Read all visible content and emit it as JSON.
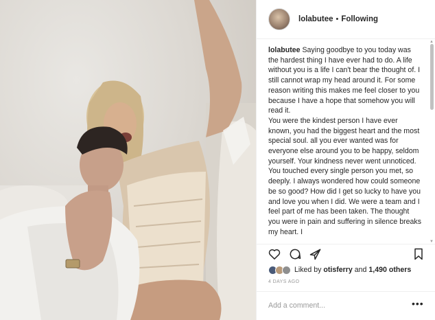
{
  "post": {
    "username": "lolabutee",
    "separator": "•",
    "following_label": "Following"
  },
  "caption": {
    "username": "lolabutee",
    "paragraphs": [
      "Saying goodbye to you today was the hardest thing I have ever had to do. A life without you is a life I can't bear the thought of. I still cannot wrap my head around it. For some reason writing this makes me feel closer to you because I have a hope that somehow you will read it.",
      "You were the kindest person I have ever known, you had the biggest heart and the most special soul. all you ever wanted was for everyone else around you to be happy, seldom yourself. Your kindness never went unnoticed.",
      "You touched every single person you met, so deeply. I always wondered how could someone be so good? How did I get so lucky to have you and love you when I did. We were a team and I feel part of me has been taken. The thought you were in pain and suffering in silence breaks my heart. I"
    ]
  },
  "likes": {
    "prefix": "Liked by",
    "user": "otisferry",
    "joiner": "and",
    "count": "1,490 others"
  },
  "date_label": "4 DAYS AGO",
  "comment": {
    "placeholder": "Add a comment...",
    "more_label": "•••"
  },
  "icons": [
    "heart-icon",
    "comment-icon",
    "share-icon",
    "bookmark-icon"
  ],
  "colors": {
    "text": "#262626",
    "muted": "#999999",
    "divider": "#efefef"
  }
}
